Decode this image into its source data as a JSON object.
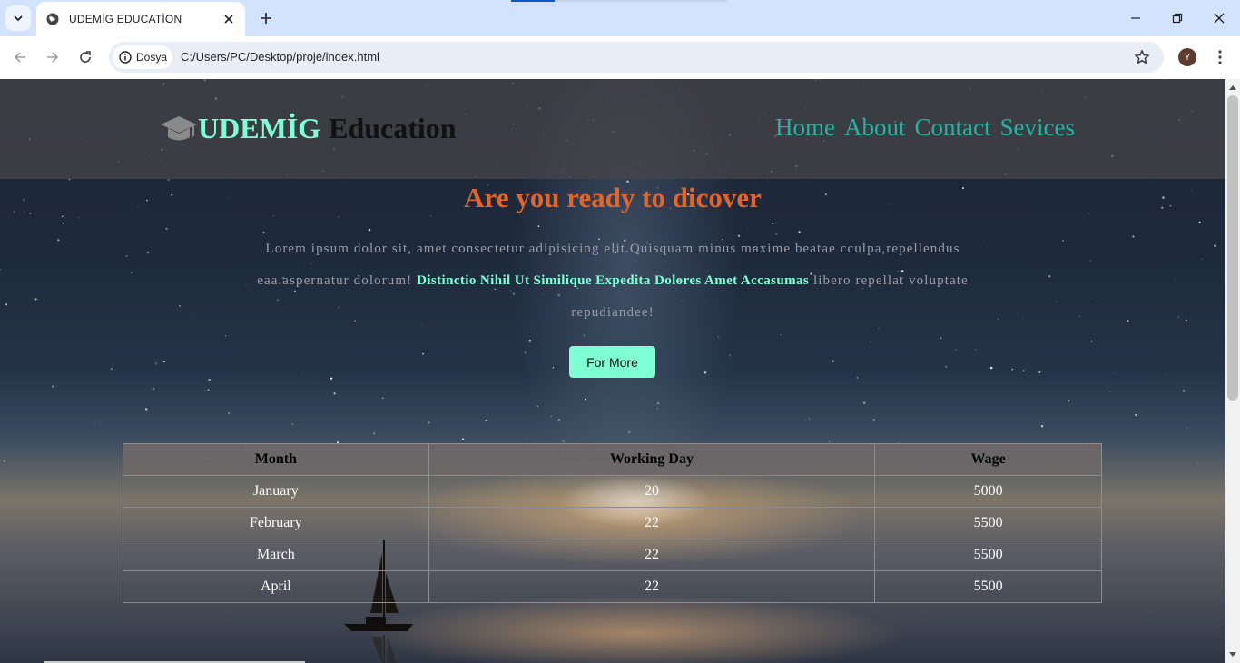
{
  "browser": {
    "tab_title": "UDEMİG EDUCATİON",
    "site_chip": "Dosya",
    "url": "C:/Users/PC/Desktop/proje/index.html",
    "profile_initial": "Y"
  },
  "page": {
    "logo": {
      "brand": "UDEMİG",
      "suffix": "Education",
      "icon": "graduation-cap-icon"
    },
    "nav": [
      {
        "label": "Home"
      },
      {
        "label": "About"
      },
      {
        "label": "Contact"
      },
      {
        "label": "Sevices"
      }
    ],
    "hero": {
      "title": "Are you ready to dicover",
      "text_before": "Lorem ipsum dolor sit, amet consectetur adipisicing elit.Quisquam minus maxime beatae cculpa,repellendus eaa.aspernatur dolorum! ",
      "text_strong": "Distinctio Nihil Ut Similique Expedita Dolores Amet Accasumas",
      "text_after": " libero repellat voluptate repudiandee!",
      "button": "For More"
    },
    "table": {
      "headers": [
        "Month",
        "Working Day",
        "Wage"
      ],
      "rows": [
        [
          "January",
          "20",
          "5000"
        ],
        [
          "February",
          "22",
          "5500"
        ],
        [
          "March",
          "22",
          "5500"
        ],
        [
          "April",
          "22",
          "5500"
        ]
      ]
    }
  },
  "colors": {
    "accent": "#7fffd4",
    "nav": "#23b3a5",
    "title": "#e0662c"
  }
}
